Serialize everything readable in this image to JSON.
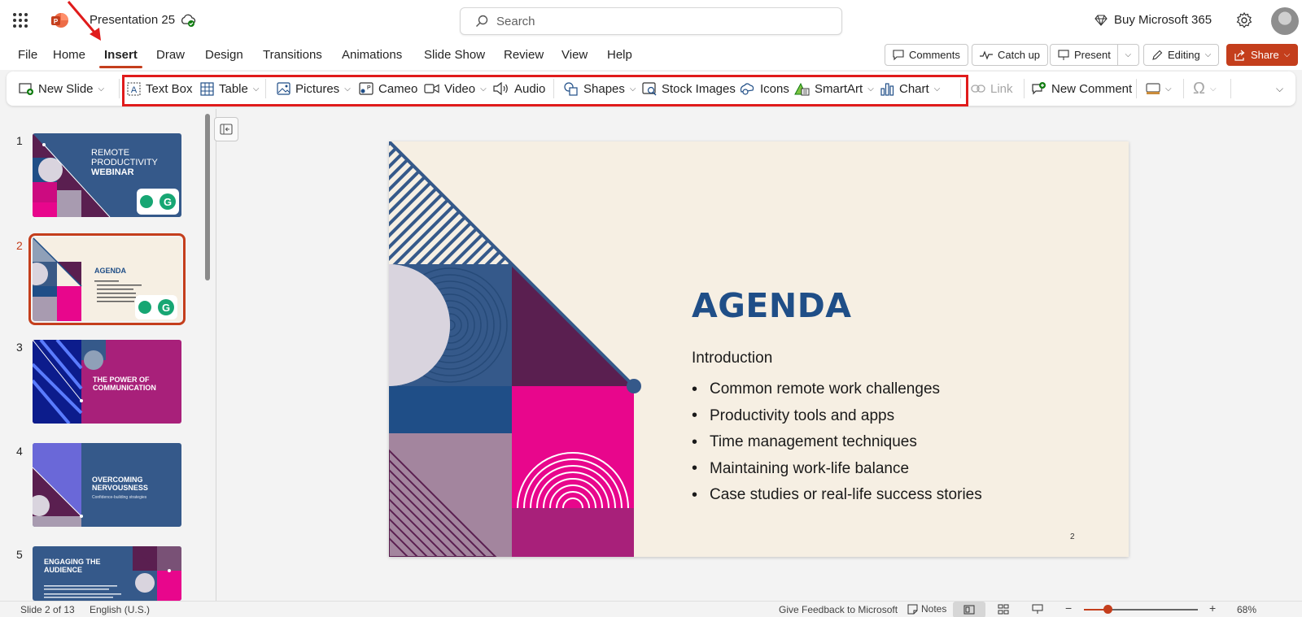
{
  "app": {
    "title": "Presentation 25",
    "search_placeholder": "Search",
    "buy_label": "Buy Microsoft 365"
  },
  "tabs": [
    {
      "label": "File"
    },
    {
      "label": "Home"
    },
    {
      "label": "Insert",
      "active": true
    },
    {
      "label": "Draw"
    },
    {
      "label": "Design"
    },
    {
      "label": "Transitions"
    },
    {
      "label": "Animations"
    },
    {
      "label": "Slide Show"
    },
    {
      "label": "Review"
    },
    {
      "label": "View"
    },
    {
      "label": "Help"
    }
  ],
  "right_buttons": {
    "comments": "Comments",
    "catch_up": "Catch up",
    "present": "Present",
    "editing": "Editing",
    "share": "Share"
  },
  "ribbon": {
    "new_slide": "New Slide",
    "text_box": "Text Box",
    "table": "Table",
    "pictures": "Pictures",
    "cameo": "Cameo",
    "video": "Video",
    "audio": "Audio",
    "shapes": "Shapes",
    "stock_images": "Stock Images",
    "icons": "Icons",
    "smartart": "SmartArt",
    "chart": "Chart",
    "link": "Link",
    "new_comment": "New Comment"
  },
  "thumbnails": [
    {
      "num": "1",
      "line1": "REMOTE",
      "line2": "PRODUCTIVITY",
      "line3": "WEBINAR"
    },
    {
      "num": "2",
      "title": "AGENDA"
    },
    {
      "num": "3",
      "line1": "THE POWER OF",
      "line2": "COMMUNICATION"
    },
    {
      "num": "4",
      "line1": "OVERCOMING",
      "line2": "NERVOUSNESS",
      "sub": "Confidence-building strategies"
    },
    {
      "num": "5",
      "line1": "ENGAGING THE",
      "line2": "AUDIENCE"
    }
  ],
  "slide": {
    "title": "AGENDA",
    "intro": "Introduction",
    "bullets": [
      "Common remote work challenges",
      "Productivity tools and apps",
      "Time management techniques",
      "Maintaining work-life balance",
      "Case studies or real-life success stories"
    ],
    "page_number": "2"
  },
  "status": {
    "slide_count": "Slide 2 of 13",
    "language": "English (U.S.)",
    "feedback": "Give Feedback to Microsoft",
    "notes": "Notes",
    "zoom": "68%"
  },
  "colors": {
    "accent": "#c43e1c",
    "slide_bg": "#f6efe3",
    "navy": "#1f4e87",
    "magenta": "#e8068c",
    "plum": "#5a1f50",
    "highlight_red": "#e01b1b"
  }
}
